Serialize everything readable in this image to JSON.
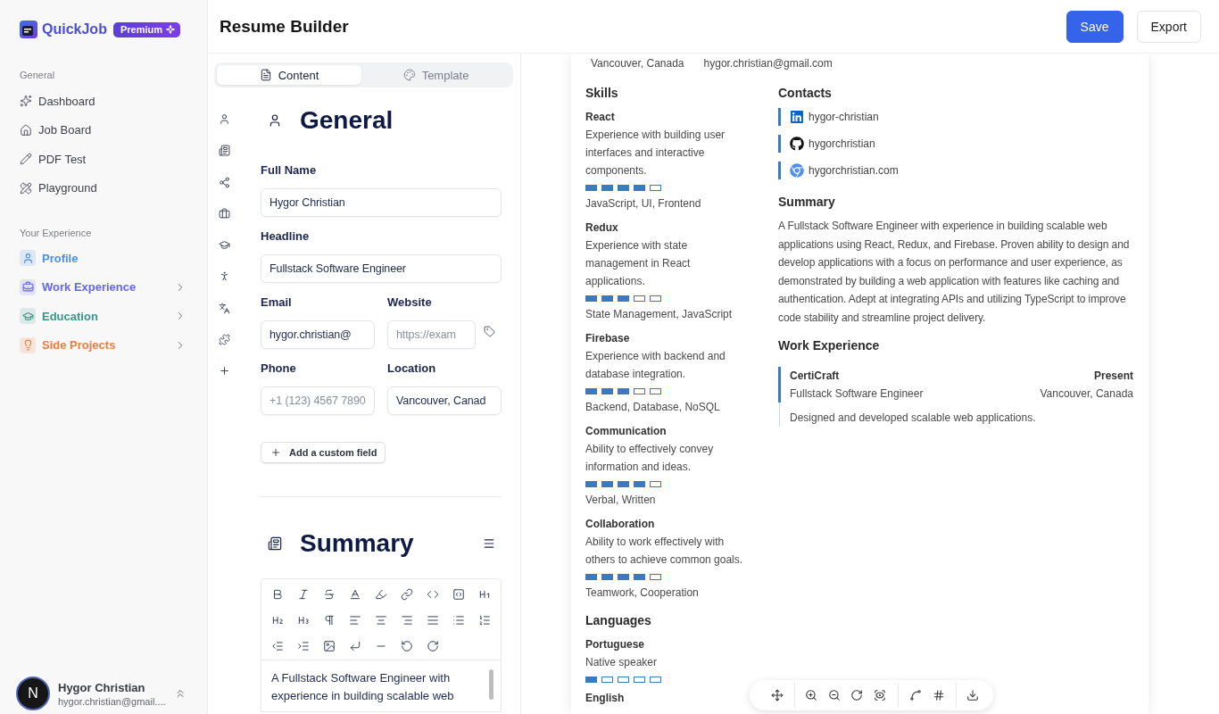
{
  "sidebar": {
    "brand": "QuickJob",
    "badge": "Premium",
    "sections": [
      {
        "title": "General",
        "items": [
          {
            "label": "Dashboard"
          },
          {
            "label": "Job Board"
          },
          {
            "label": "PDF Test"
          },
          {
            "label": "Playground"
          }
        ]
      },
      {
        "title": "Your Experience",
        "items": [
          {
            "label": "Profile",
            "color": "#4a8fe0",
            "expandable": false
          },
          {
            "label": "Work Experience",
            "color": "#6366f1",
            "expandable": true
          },
          {
            "label": "Education",
            "color": "#3d9488",
            "expandable": true
          },
          {
            "label": "Side Projects",
            "color": "#f07a3a",
            "expandable": true
          }
        ]
      }
    ],
    "user": {
      "avatar_letter": "N",
      "name": "Hygor Christian",
      "email": "hygor.christian@gmail...."
    }
  },
  "header": {
    "title": "Resume Builder",
    "buttons": [
      {
        "label": "Save",
        "kind": "primary"
      },
      {
        "label": "Export",
        "kind": "secondary"
      }
    ]
  },
  "editor": {
    "tabs": [
      {
        "label": "Content",
        "selected": true
      },
      {
        "label": "Template",
        "selected": false
      }
    ],
    "general": {
      "title": "General",
      "fields": [
        {
          "label": "Full Name",
          "kind": "wide",
          "value": "Hygor Christian"
        },
        {
          "label": "Headline",
          "kind": "wide",
          "value": "Fullstack Software Engineer"
        },
        {
          "label": "Email",
          "kind": "half",
          "value": "hygor.christian@"
        },
        {
          "label": "Website",
          "kind": "link",
          "placeholder": "https://exam"
        },
        {
          "label": "Phone",
          "kind": "half",
          "placeholder": "+1 (123) 4567 7890"
        },
        {
          "label": "Location",
          "kind": "half",
          "value": "Vancouver, Canad"
        }
      ],
      "add_button": "Add a custom field"
    },
    "summary": {
      "title": "Summary",
      "text": "A Fullstack Software Engineer with experience in building scalable web"
    }
  },
  "resume": {
    "header_info": [
      "Vancouver, Canada",
      "hygor.christian@gmail.com"
    ],
    "skills": {
      "title": "Skills",
      "items": [
        {
          "name": "React",
          "description": "Experience with building user interfaces and interactive components.",
          "level": 0.8,
          "keywords": "JavaScript, UI, Frontend"
        },
        {
          "name": "Redux",
          "description": "Experience with state management in React applications.",
          "level": 0.6,
          "keywords": "State Management, JavaScript"
        },
        {
          "name": "Firebase",
          "description": "Experience with backend and database integration.",
          "level": 0.6,
          "keywords": "Backend, Database, NoSQL"
        },
        {
          "name": "Communication",
          "description": "Ability to effectively convey information and ideas.",
          "level": 0.8,
          "keywords": "Verbal, Written"
        },
        {
          "name": "Collaboration",
          "description": "Ability to work effectively with others to achieve common goals.",
          "level": 0.8,
          "keywords": "Teamwork, Cooperation"
        }
      ]
    },
    "languages": {
      "title": "Languages",
      "items": [
        {
          "name": "Portuguese",
          "description": "Native speaker",
          "level": 0.2
        },
        {
          "name": "English"
        }
      ]
    },
    "contacts": {
      "title": "Contacts",
      "items": [
        {
          "kind": "linkedin",
          "label": "hygor-christian"
        },
        {
          "kind": "github",
          "label": "hygorchristian"
        },
        {
          "kind": "website",
          "label": "hygorchristian.com"
        }
      ]
    },
    "summary": {
      "title": "Summary",
      "text": "A Fullstack Software Engineer with experience in building scalable web applications using React, Redux, and Firebase. Proven ability to design and develop applications with a focus on performance and user experience, as demonstrated by building a web application with features like caching and authentication. Adept at integrating APIs and utilizing TypeScript to improve code stability and streamline project delivery."
    },
    "work": {
      "title": "Work Experience",
      "items": [
        {
          "company": "CertiCraft",
          "date": "Present",
          "position": "Fullstack Software Engineer",
          "location": "Vancouver, Canada",
          "description": "Designed and developed scalable web applications."
        }
      ]
    }
  }
}
